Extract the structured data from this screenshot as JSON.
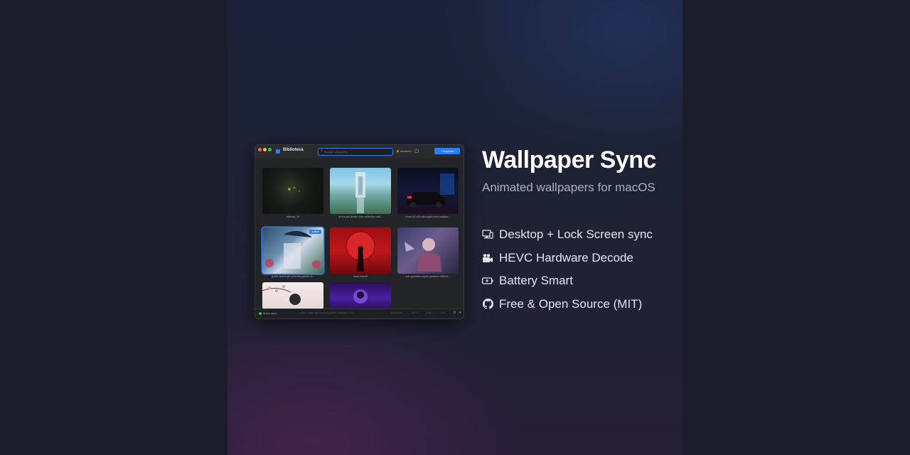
{
  "hero": {
    "title": "Wallpaper Sync",
    "subtitle": "Animated wallpapers for macOS",
    "features": [
      {
        "icon": "desktop-monitor-icon",
        "label": "Desktop + Lock Screen sync"
      },
      {
        "icon": "video-camera-icon",
        "label": "HEVC Hardware Decode"
      },
      {
        "icon": "battery-icon",
        "label": "Battery Smart"
      },
      {
        "icon": "github-icon",
        "label": "Free & Open Source (MIT)"
      }
    ]
  },
  "app": {
    "sidebar_title": "Biblioteca",
    "search_placeholder": "Buscar wallpapers",
    "random_label": "⚡ Aleatório",
    "import_label": "+ Importar",
    "tiles": [
      {
        "caption": "abstract_4k",
        "active": false
      },
      {
        "caption": "anime-girl-dream-door-reflection-wall...",
        "active": false
      },
      {
        "caption": "bmw-m3-e46-rain-night-neon-wallpap...",
        "active": false
      },
      {
        "caption": "gothic-anime-girl-umbrella-garden-w...",
        "active": true,
        "badge": "● Ativo"
      },
      {
        "caption": "hecki-mecott",
        "active": false
      },
      {
        "caption": "star-guardian-xayah-goddess-3840x2...",
        "active": false
      },
      {
        "caption": "",
        "active": false
      },
      {
        "caption": "",
        "active": false
      }
    ],
    "status": {
      "state": "Motor ativo",
      "path": "↳ gothic-anime-girl-umbrella-garden-wallpaper.mov",
      "resolution": "3840×2160",
      "codec": "HEVC",
      "fps": "30fps",
      "duration": "0:12"
    }
  },
  "colors": {
    "accent": "#2d7df6",
    "background": "#1c1d2c"
  }
}
